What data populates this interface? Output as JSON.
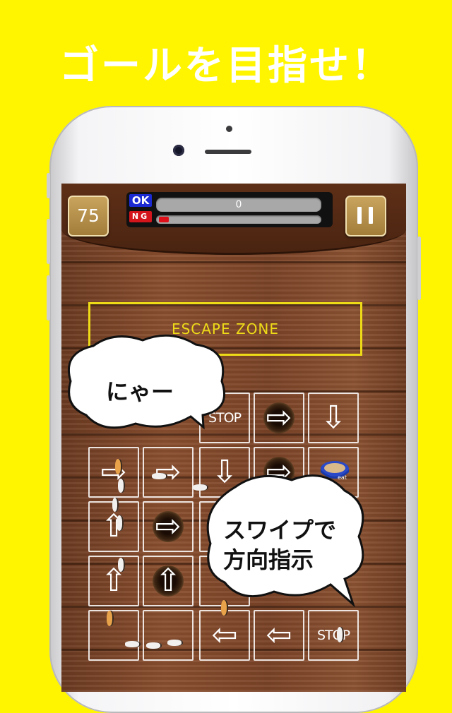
{
  "headline": "ゴールを目指せ！",
  "hud": {
    "counter": "75",
    "ok_label": "OK",
    "ng_label": "NG",
    "ok_value": "0",
    "ng_progress": 0.06
  },
  "board": {
    "zone_label": "ESCAPE ZONE",
    "stop_label": "STOP",
    "bowl_label": "eat"
  },
  "bubbles": {
    "meow": "にゃー",
    "instruction_line1": "スワイプで",
    "instruction_line2": "方向指示"
  },
  "colors": {
    "background": "#fff500",
    "zone_border": "#eedb18",
    "ok_label": "#1b2ad2",
    "ng_label": "#d4151c"
  },
  "icons": [
    "pause-icon",
    "arrow-right-icon",
    "arrow-left-icon",
    "arrow-up-icon",
    "arrow-down-icon",
    "stop-sign",
    "hole",
    "cat-food-bowl"
  ]
}
